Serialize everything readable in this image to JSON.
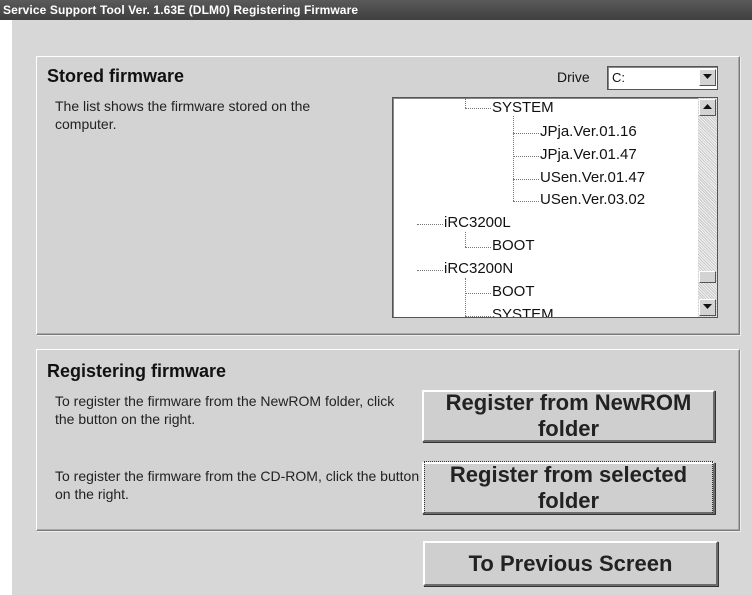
{
  "window": {
    "title": "Service Support Tool Ver. 1.63E (DLM0)   Registering Firmware"
  },
  "stored_firmware": {
    "title": "Stored firmware",
    "description": "The list shows the firmware stored on the computer.",
    "drive_label": "Drive",
    "drive_value": "C:",
    "tree_items": [
      {
        "label": "SYSTEM",
        "level": 2
      },
      {
        "label": "JPja.Ver.01.16",
        "level": 3
      },
      {
        "label": "JPja.Ver.01.47",
        "level": 3
      },
      {
        "label": "USen.Ver.01.47",
        "level": 3
      },
      {
        "label": "USen.Ver.03.02",
        "level": 3
      },
      {
        "label": "iRC3200L",
        "level": 1
      },
      {
        "label": "BOOT",
        "level": 2
      },
      {
        "label": "iRC3200N",
        "level": 1
      },
      {
        "label": "BOOT",
        "level": 2
      },
      {
        "label": "SYSTEM",
        "level": 2
      }
    ]
  },
  "registering_firmware": {
    "title": "Registering firmware",
    "newrom_description": "To register the firmware from the NewROM folder, click the button on the right.",
    "cdrom_description": "To register the firmware from the CD-ROM, click the button on the right.",
    "newrom_button": "Register from NewROM folder",
    "selected_button": "Register from selected folder"
  },
  "footer": {
    "previous_button": "To Previous Screen"
  },
  "icons": [
    "dropdown-arrow-icon",
    "scroll-up-icon",
    "scroll-down-icon"
  ]
}
